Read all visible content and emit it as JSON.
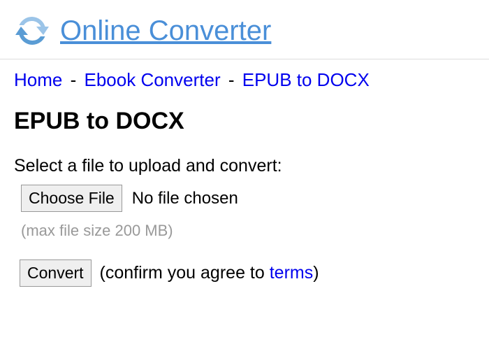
{
  "header": {
    "site_title": "Online Converter"
  },
  "breadcrumb": {
    "home": "Home",
    "sep": "-",
    "category": "Ebook Converter",
    "current": "EPUB to DOCX"
  },
  "page": {
    "title": "EPUB to DOCX",
    "upload_label": "Select a file to upload and convert:",
    "choose_file_button": "Choose File",
    "file_status": "No file chosen",
    "max_size": "(max file size 200 MB)",
    "convert_button": "Convert",
    "confirm_prefix": "(confirm you agree to ",
    "terms_link": "terms",
    "confirm_suffix": ")"
  }
}
